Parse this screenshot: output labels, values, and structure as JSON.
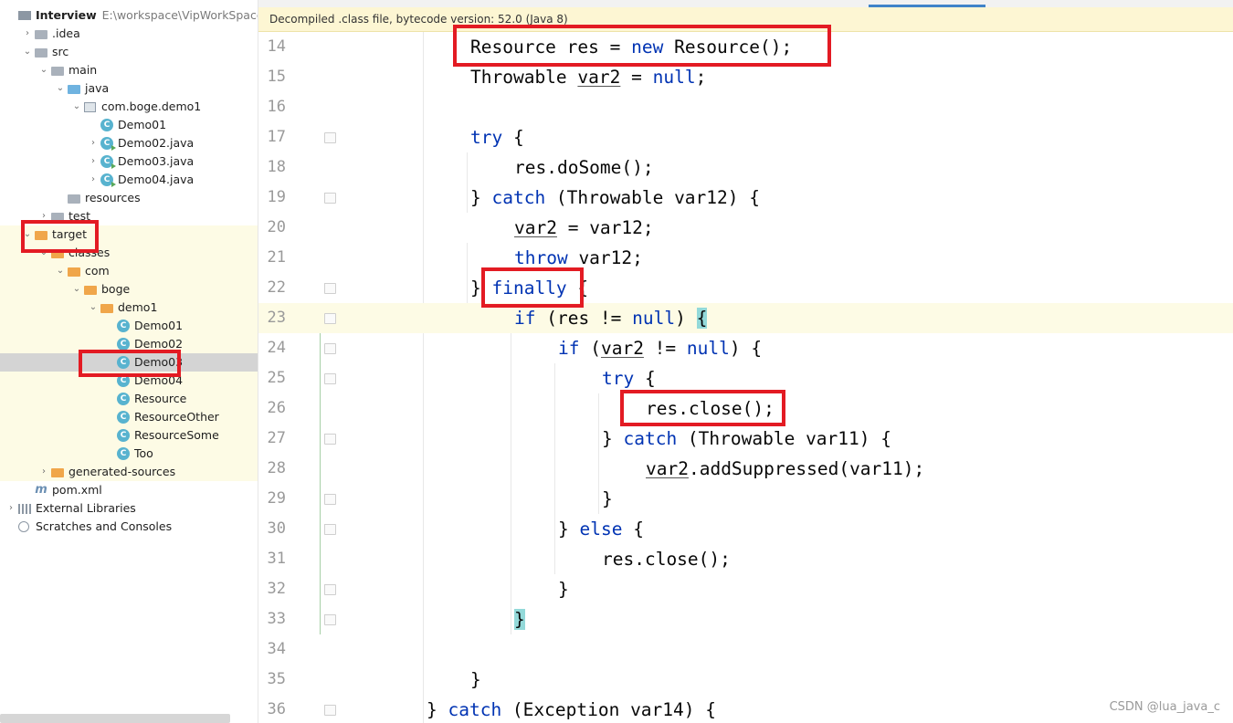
{
  "project_tree": {
    "items": [
      {
        "label": "Interview",
        "path": "E:\\workspace\\VipWorkSpace\\Inte",
        "icon": "project-icon",
        "depth": 0,
        "arrow": "",
        "bold": true
      },
      {
        "label": ".idea",
        "icon": "folder-icon",
        "depth": 1,
        "arrow": "›"
      },
      {
        "label": "src",
        "icon": "folder-icon",
        "depth": 1,
        "arrow": "⌄"
      },
      {
        "label": "main",
        "icon": "folder-icon",
        "depth": 2,
        "arrow": "⌄"
      },
      {
        "label": "java",
        "icon": "source-folder-icon",
        "depth": 3,
        "arrow": "⌄"
      },
      {
        "label": "com.boge.demo1",
        "icon": "package-icon",
        "depth": 4,
        "arrow": "⌄"
      },
      {
        "label": "Demo01",
        "icon": "class-icon",
        "depth": 5,
        "arrow": ""
      },
      {
        "label": "Demo02.java",
        "icon": "class-icon",
        "depth": 5,
        "arrow": "›"
      },
      {
        "label": "Demo03.java",
        "icon": "class-icon",
        "depth": 5,
        "arrow": "›"
      },
      {
        "label": "Demo04.java",
        "icon": "class-icon",
        "depth": 5,
        "arrow": "›"
      },
      {
        "label": "resources",
        "icon": "resources-folder-icon",
        "depth": 3,
        "arrow": ""
      },
      {
        "label": "test",
        "icon": "folder-icon",
        "depth": 2,
        "arrow": "›"
      },
      {
        "label": "target",
        "icon": "excluded-folder-icon",
        "depth": 1,
        "arrow": "⌄",
        "yellow": true
      },
      {
        "label": "classes",
        "icon": "excluded-folder-icon",
        "depth": 2,
        "arrow": "⌄",
        "yellow": true
      },
      {
        "label": "com",
        "icon": "excluded-folder-icon",
        "depth": 3,
        "arrow": "⌄",
        "yellow": true
      },
      {
        "label": "boge",
        "icon": "excluded-folder-icon",
        "depth": 4,
        "arrow": "⌄",
        "yellow": true
      },
      {
        "label": "demo1",
        "icon": "excluded-folder-icon",
        "depth": 5,
        "arrow": "⌄",
        "yellow": true
      },
      {
        "label": "Demo01",
        "icon": "class-file-icon",
        "depth": 6,
        "arrow": "",
        "yellow": true
      },
      {
        "label": "Demo02",
        "icon": "class-file-icon",
        "depth": 6,
        "arrow": "",
        "yellow": true
      },
      {
        "label": "Demo03",
        "icon": "class-file-icon",
        "depth": 6,
        "arrow": "",
        "selected": true
      },
      {
        "label": "Demo04",
        "icon": "class-file-icon",
        "depth": 6,
        "arrow": "",
        "yellow": true
      },
      {
        "label": "Resource",
        "icon": "class-file-icon",
        "depth": 6,
        "arrow": "",
        "yellow": true
      },
      {
        "label": "ResourceOther",
        "icon": "class-file-icon",
        "depth": 6,
        "arrow": "",
        "yellow": true
      },
      {
        "label": "ResourceSome",
        "icon": "class-file-icon",
        "depth": 6,
        "arrow": "",
        "yellow": true
      },
      {
        "label": "Too",
        "icon": "class-file-icon",
        "depth": 6,
        "arrow": "",
        "yellow": true
      },
      {
        "label": "generated-sources",
        "icon": "excluded-folder-icon",
        "depth": 2,
        "arrow": "›",
        "yellow": true
      },
      {
        "label": "pom.xml",
        "icon": "maven-icon",
        "depth": 1,
        "arrow": ""
      },
      {
        "label": "External Libraries",
        "icon": "library-icon",
        "depth": 0,
        "arrow": "›"
      },
      {
        "label": "Scratches and Consoles",
        "icon": "scratch-icon",
        "depth": 0,
        "arrow": ""
      }
    ]
  },
  "editor": {
    "banner": "Decompiled .class file, bytecode version: 52.0 (Java 8)",
    "lines": [
      {
        "num": "14",
        "indent": 10,
        "tokens": [
          [
            "t",
            "Resource res = "
          ],
          [
            "k",
            "new"
          ],
          [
            "t",
            " Resource();"
          ]
        ],
        "fold": ""
      },
      {
        "num": "15",
        "indent": 10,
        "tokens": [
          [
            "t",
            "Throwable "
          ],
          [
            "u",
            "var2"
          ],
          [
            "t",
            " = "
          ],
          [
            "k",
            "null"
          ],
          [
            "t",
            ";"
          ]
        ],
        "fold": ""
      },
      {
        "num": "16",
        "indent": 0,
        "tokens": [],
        "fold": ""
      },
      {
        "num": "17",
        "indent": 10,
        "tokens": [
          [
            "k",
            "try"
          ],
          [
            "t",
            " {"
          ]
        ],
        "fold": "down"
      },
      {
        "num": "18",
        "indent": 12,
        "tokens": [
          [
            "t",
            "res.doSome();"
          ]
        ],
        "fold": ""
      },
      {
        "num": "19",
        "indent": 10,
        "tokens": [
          [
            "t",
            "} "
          ],
          [
            "k",
            "catch"
          ],
          [
            "t",
            " (Throwable var12) {"
          ]
        ],
        "fold": "up"
      },
      {
        "num": "20",
        "indent": 12,
        "tokens": [
          [
            "u",
            "var2"
          ],
          [
            "t",
            " = var12;"
          ]
        ],
        "fold": ""
      },
      {
        "num": "21",
        "indent": 12,
        "tokens": [
          [
            "k",
            "throw"
          ],
          [
            "t",
            " var12;"
          ]
        ],
        "fold": ""
      },
      {
        "num": "22",
        "indent": 10,
        "tokens": [
          [
            "t",
            "} "
          ],
          [
            "k",
            "finally"
          ],
          [
            "t",
            " {"
          ]
        ],
        "fold": "up"
      },
      {
        "num": "23",
        "indent": 12,
        "tokens": [
          [
            "k",
            "if"
          ],
          [
            "t",
            " (res != "
          ],
          [
            "k",
            "null"
          ],
          [
            "t",
            ") "
          ],
          [
            "b",
            "{"
          ]
        ],
        "fold": "down",
        "caret": true
      },
      {
        "num": "24",
        "indent": 14,
        "tokens": [
          [
            "k",
            "if"
          ],
          [
            "t",
            " ("
          ],
          [
            "u",
            "var2"
          ],
          [
            "t",
            " != "
          ],
          [
            "k",
            "null"
          ],
          [
            "t",
            ") {"
          ]
        ],
        "fold": "down"
      },
      {
        "num": "25",
        "indent": 16,
        "tokens": [
          [
            "k",
            "try"
          ],
          [
            "t",
            " {"
          ]
        ],
        "fold": "down"
      },
      {
        "num": "26",
        "indent": 18,
        "tokens": [
          [
            "t",
            "res.close();"
          ]
        ],
        "fold": ""
      },
      {
        "num": "27",
        "indent": 16,
        "tokens": [
          [
            "t",
            "} "
          ],
          [
            "k",
            "catch"
          ],
          [
            "t",
            " (Throwable var11) {"
          ]
        ],
        "fold": "up"
      },
      {
        "num": "28",
        "indent": 18,
        "tokens": [
          [
            "u",
            "var2"
          ],
          [
            "t",
            ".addSuppressed(var11);"
          ]
        ],
        "fold": ""
      },
      {
        "num": "29",
        "indent": 16,
        "tokens": [
          [
            "t",
            "}"
          ]
        ],
        "fold": "up"
      },
      {
        "num": "30",
        "indent": 14,
        "tokens": [
          [
            "t",
            "} "
          ],
          [
            "k",
            "else"
          ],
          [
            "t",
            " {"
          ]
        ],
        "fold": "up"
      },
      {
        "num": "31",
        "indent": 16,
        "tokens": [
          [
            "t",
            "res.close();"
          ]
        ],
        "fold": ""
      },
      {
        "num": "32",
        "indent": 14,
        "tokens": [
          [
            "t",
            "}"
          ]
        ],
        "fold": "up"
      },
      {
        "num": "33",
        "indent": 12,
        "tokens": [
          [
            "b",
            "}"
          ]
        ],
        "fold": "up"
      },
      {
        "num": "34",
        "indent": 0,
        "tokens": [],
        "fold": ""
      },
      {
        "num": "35",
        "indent": 10,
        "tokens": [
          [
            "t",
            "}"
          ]
        ],
        "fold": ""
      },
      {
        "num": "36",
        "indent": 8,
        "tokens": [
          [
            "t",
            "} "
          ],
          [
            "k",
            "catch"
          ],
          [
            "t",
            " (Exception var14) {"
          ]
        ],
        "fold": "up"
      }
    ]
  },
  "watermark": "CSDN @lua_java_c",
  "colors": {
    "keyword": "#0033b3",
    "annotation_box": "#e31b23",
    "excluded_folder_bg": "#fdfbe5",
    "selection": "#d4d4d4",
    "brace_match": "#93d9d9"
  }
}
